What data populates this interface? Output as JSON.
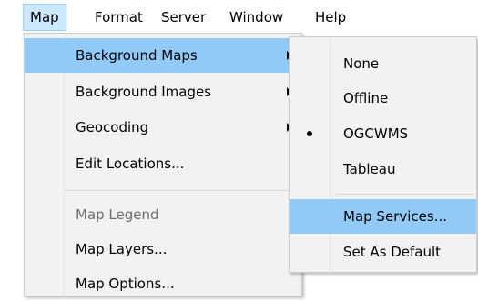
{
  "menubar": {
    "items": [
      {
        "label": "Map"
      },
      {
        "label": "Format"
      },
      {
        "label": "Server"
      },
      {
        "label": "Window"
      },
      {
        "label": "Help"
      }
    ]
  },
  "map_menu": {
    "items": [
      {
        "label": "Background Maps",
        "has_submenu": true,
        "highlighted": true
      },
      {
        "label": "Background Images",
        "has_submenu": true
      },
      {
        "label": "Geocoding",
        "has_submenu": true
      },
      {
        "label": "Edit Locations..."
      },
      {
        "label": "Map Legend",
        "disabled": true
      },
      {
        "label": "Map Layers..."
      },
      {
        "label": "Map Options..."
      }
    ]
  },
  "background_maps_menu": {
    "items": [
      {
        "label": "None"
      },
      {
        "label": "Offline"
      },
      {
        "label": "OGCWMS",
        "selected": true
      },
      {
        "label": "Tableau"
      },
      {
        "label": "Map Services...",
        "highlighted": true
      },
      {
        "label": "Set As Default"
      }
    ]
  },
  "colors": {
    "highlight": "#91c9f7",
    "menubar_open": "#cce8ff",
    "menu_background": "#f2f2f2",
    "disabled_text": "#6d6d6d"
  }
}
